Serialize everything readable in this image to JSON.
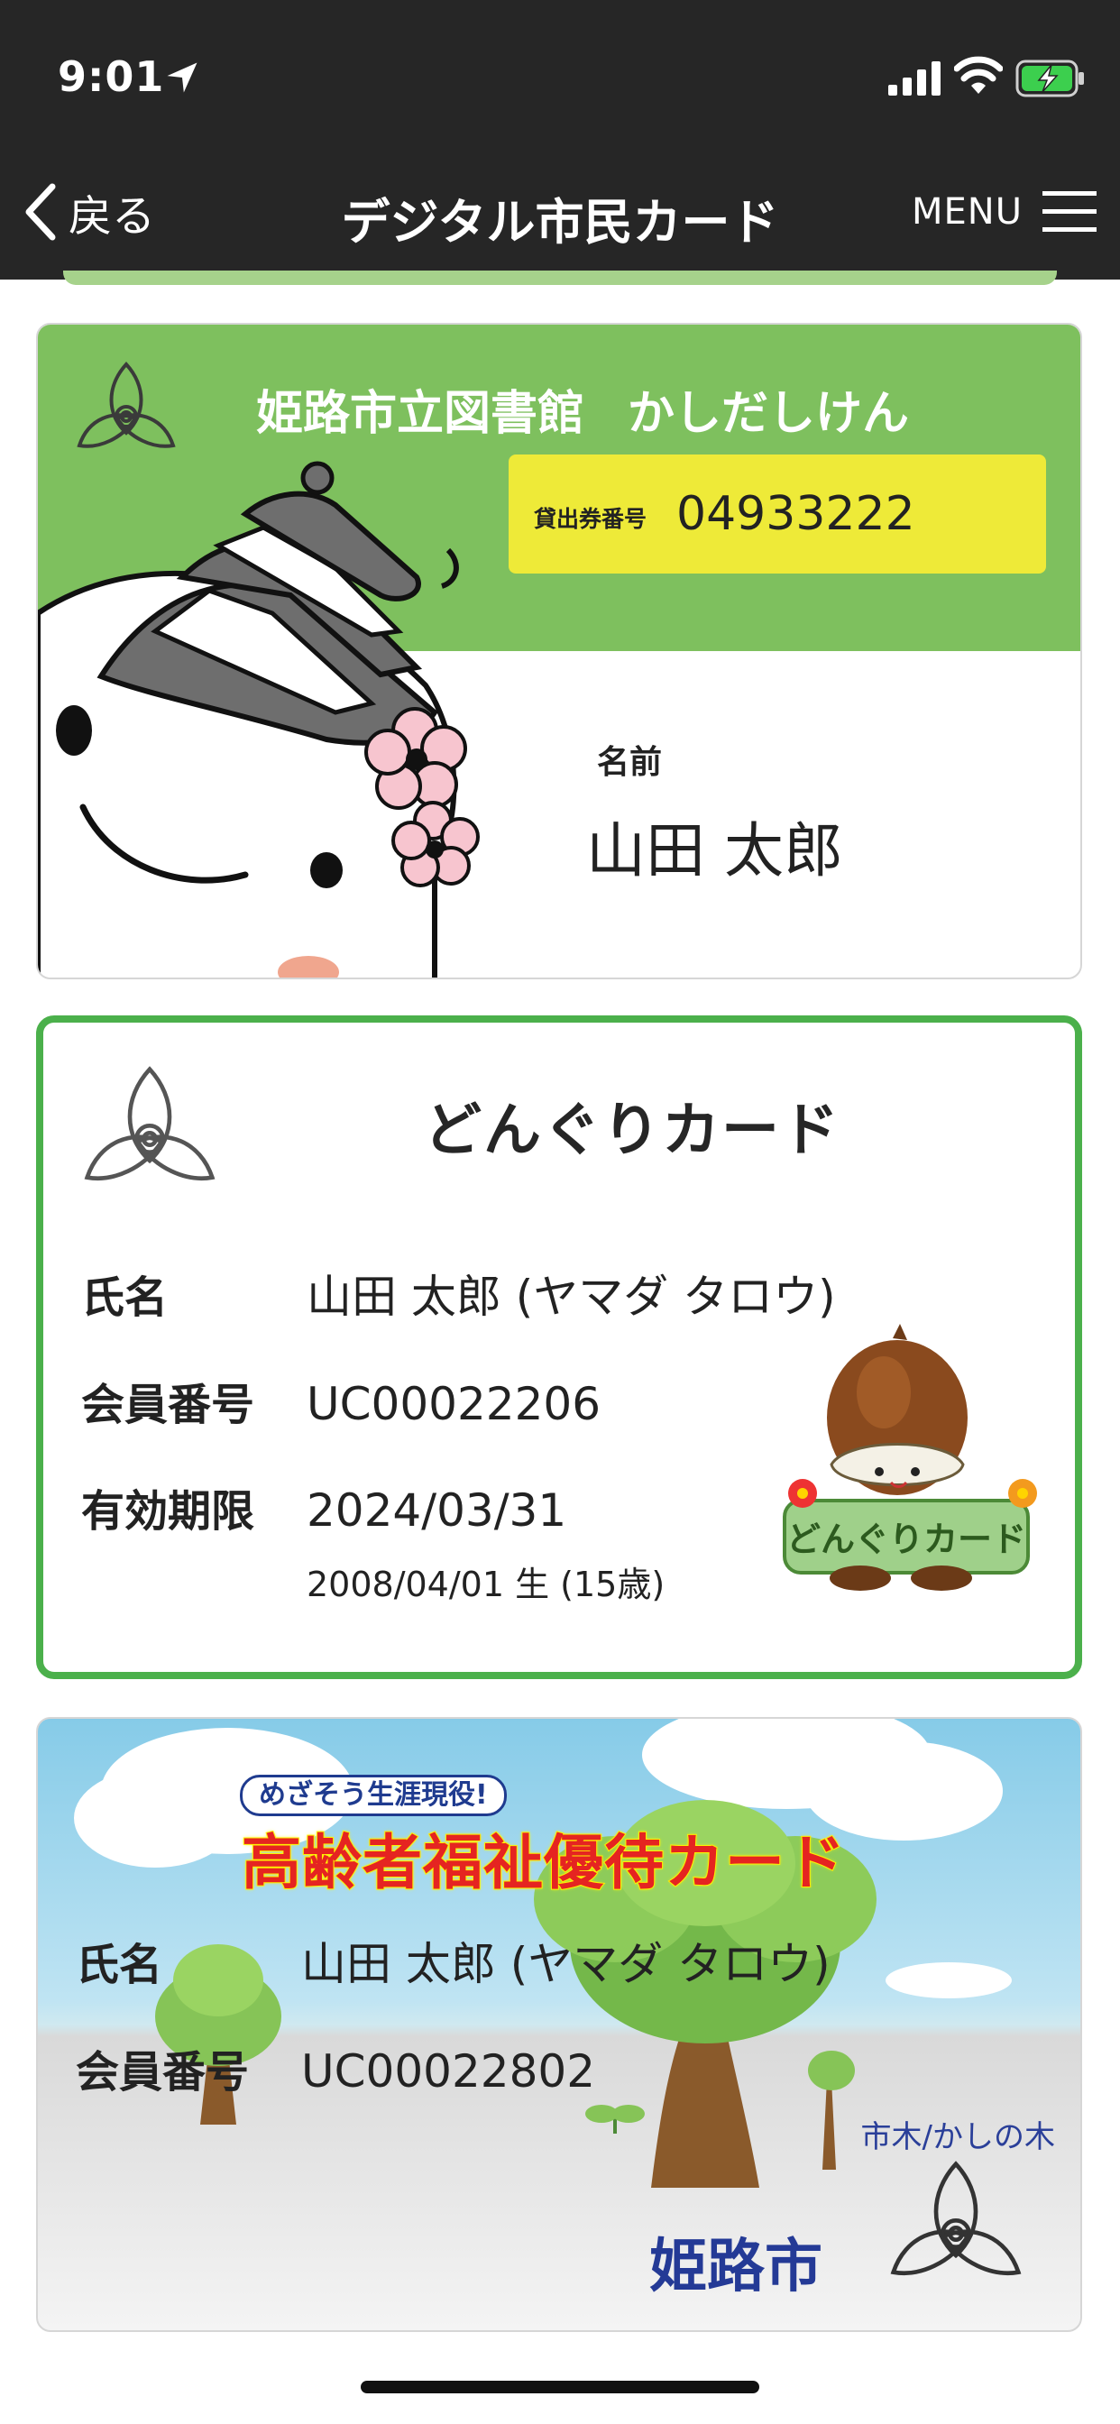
{
  "status_bar": {
    "time": "9:01"
  },
  "nav": {
    "back_label": "戻る",
    "title": "デジタル市民カード",
    "menu_label": "MENU"
  },
  "library_card": {
    "title": "姫路市立図書館",
    "subtitle": "かしだしけん",
    "number_label": "貸出券番号",
    "number": "04933222",
    "name_label": "名前",
    "name": "山田 太郎"
  },
  "donguri_card": {
    "title": "どんぐりカード",
    "rows": [
      {
        "label": "氏名",
        "value": "山田 太郎 (ヤマダ タロウ)"
      },
      {
        "label": "会員番号",
        "value": "UC00022206"
      },
      {
        "label": "有効期限",
        "value": "2024/03/31"
      }
    ],
    "birth": "2008/04/01 生 (15歳)",
    "mascot_sign": "どんぐりカード"
  },
  "senior_card": {
    "badge": "めざそう生涯現役!",
    "title": "高齢者福祉優待カード",
    "rows": [
      {
        "label": "氏名",
        "value": "山田 太郎 (ヤマダ タロウ)"
      },
      {
        "label": "会員番号",
        "value": "UC00022802"
      }
    ],
    "tree_label": "市木/かしの木",
    "city": "姫路市"
  },
  "colors": {
    "bar": "#262626",
    "library_green": "#7ec05e",
    "number_yellow": "#eeea38",
    "donguri_border": "#4bb04b",
    "senior_title_red": "#e52421",
    "senior_navy": "#243a96"
  },
  "icons": [
    "location-arrow-icon",
    "signal-icon",
    "wifi-icon",
    "battery-charging-icon",
    "back-chevron-icon",
    "hamburger-menu-icon",
    "city-emblem-icon"
  ]
}
